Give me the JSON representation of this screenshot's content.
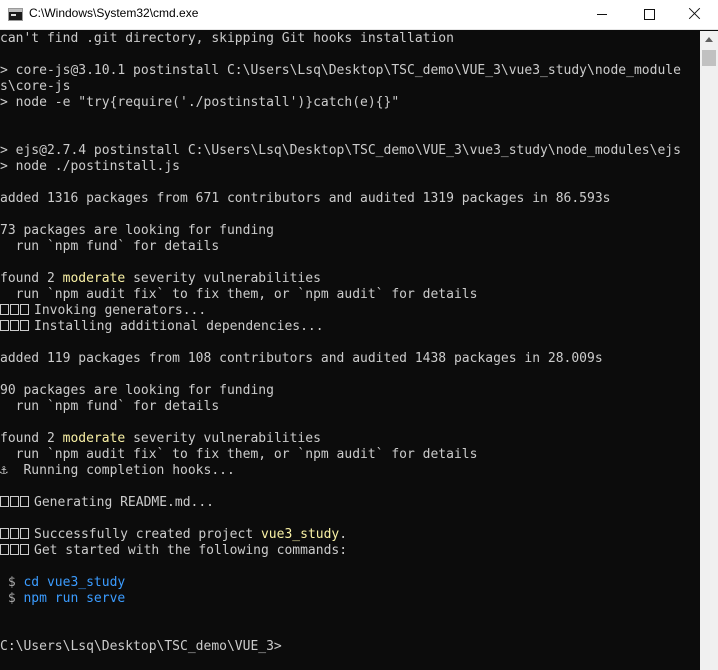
{
  "window": {
    "title": "C:\\Windows\\System32\\cmd.exe",
    "icon": "cmd-console-icon"
  },
  "controls": {
    "minimize": "minimize-icon",
    "maximize": "maximize-icon",
    "close": "close-icon"
  },
  "colors": {
    "background": "#0c0c0c",
    "text": "#cccccc",
    "warning": "#f9f1a5",
    "accent": "#3b9cff"
  },
  "console": {
    "l01": "can't find .git directory, skipping Git hooks installation",
    "l02": "> core-js@3.10.1 postinstall C:\\Users\\Lsq\\Desktop\\TSC_demo\\VUE_3\\vue3_study\\node_module",
    "l03": "s\\core-js",
    "l04": "> node -e \"try{require('./postinstall')}catch(e){}\"",
    "l05": "> ejs@2.7.4 postinstall C:\\Users\\Lsq\\Desktop\\TSC_demo\\VUE_3\\vue3_study\\node_modules\\ejs",
    "l06": "> node ./postinstall.js",
    "l07": "added 1316 packages from 671 contributors and audited 1319 packages in 86.593s",
    "l08": "73 packages are looking for funding",
    "l09": "  run `npm fund` for details",
    "l10a": "found 2 ",
    "l10b": "moderate",
    "l10c": " severity vulnerabilities",
    "l11": "  run `npm audit fix` to fix them, or `npm audit` for details",
    "l12": "Invoking generators...",
    "l13": "Installing additional dependencies...",
    "l14": "added 119 packages from 108 contributors and audited 1438 packages in 28.009s",
    "l15": "90 packages are looking for funding",
    "l16": "  run `npm fund` for details",
    "l17a": "found 2 ",
    "l17b": "moderate",
    "l17c": " severity vulnerabilities",
    "l18": "  run `npm audit fix` to fix them, or `npm audit` for details",
    "l19a": "⚓",
    "l19b": "  Running completion hooks...",
    "l20": "Generating README.md...",
    "l21a": "Successfully created project ",
    "l21b": "vue3_study",
    "l21c": ".",
    "l22": "Get started with the following commands:",
    "l23a": " $ ",
    "l23b": "cd vue3_study",
    "l24a": " $ ",
    "l24b": "npm run serve",
    "prompt": "C:\\Users\\Lsq\\Desktop\\TSC_demo\\VUE_3>"
  }
}
